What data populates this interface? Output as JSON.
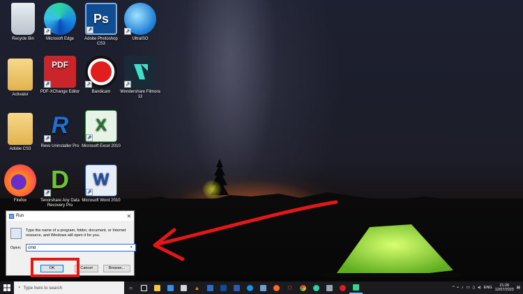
{
  "desktop": {
    "icons": [
      {
        "label": "Recycle Bin",
        "icon": "recycle-bin-icon"
      },
      {
        "label": "Microsoft Edge",
        "icon": "edge-icon"
      },
      {
        "label": "Adobe Photoshop CS3",
        "icon": "photoshop-icon",
        "glyph": "Ps"
      },
      {
        "label": "UltraISO",
        "icon": "ultraiso-icon"
      },
      {
        "label": "Activator",
        "icon": "folder-icon"
      },
      {
        "label": "PDF-XChange Editor",
        "icon": "pdf-icon",
        "glyph": "PDF"
      },
      {
        "label": "Bandicam",
        "icon": "bandicam-icon"
      },
      {
        "label": "Wondershare Filmora 12",
        "icon": "filmora-icon"
      },
      {
        "label": "Adobe CS3",
        "icon": "folder-icon"
      },
      {
        "label": "Revo Uninstaller Pro",
        "icon": "revo-icon",
        "glyph": "R"
      },
      {
        "label": "Microsoft Excel 2010",
        "icon": "excel-icon",
        "glyph": "X"
      },
      {
        "label": "Firefox",
        "icon": "firefox-icon"
      },
      {
        "label": "Tenorshare Any Data Recovery Pro",
        "icon": "tenorshare-icon",
        "glyph": "D"
      },
      {
        "label": "Microsoft Word 2010",
        "icon": "word-icon",
        "glyph": "W"
      }
    ]
  },
  "run_dialog": {
    "title": "Run",
    "close": "✕",
    "description": "Type the name of a program, folder, document, or Internet resource, and Windows will open it for you.",
    "open_label": "Open:",
    "open_value": "cmd",
    "ok": "OK",
    "cancel": "Cancel",
    "browse": "Browse..."
  },
  "taskbar": {
    "search_placeholder": "Type here to search",
    "language": "ENG",
    "time": "21:28",
    "date": "12/07/2023"
  },
  "colors": {
    "annotation": "#e01818",
    "taskbar": "#1a1a1f",
    "accent": "#0078d7"
  }
}
